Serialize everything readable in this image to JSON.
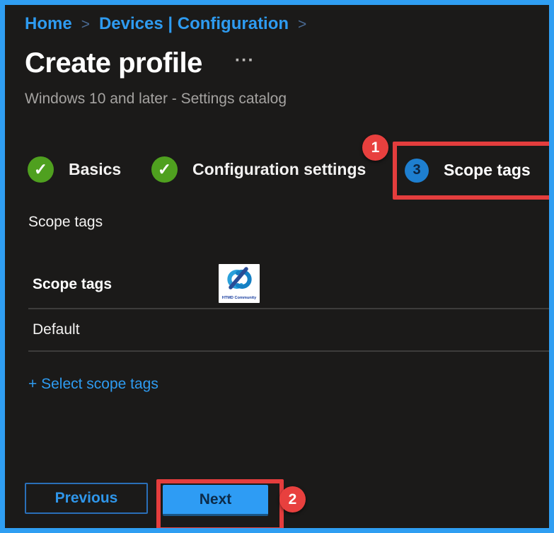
{
  "colors": {
    "frame_border": "#2f9ef2",
    "background": "#1b1a19",
    "link_blue": "#2e9bf0",
    "annotation_red": "#e43d3d",
    "step_complete_green": "#4fa01f",
    "step_current_blue": "#1e7fd0",
    "next_button_fill": "#2e9cf4",
    "divider_gray": "#3d3c3b"
  },
  "breadcrumb": {
    "items": [
      "Home",
      "Devices | Configuration"
    ],
    "separator": ">"
  },
  "header": {
    "title": "Create profile",
    "more_glyph": "···",
    "subtitle": "Windows 10 and later - Settings catalog"
  },
  "wizard": {
    "steps": [
      {
        "label": "Basics",
        "state": "complete"
      },
      {
        "label": "Configuration settings",
        "state": "complete"
      },
      {
        "label": "Scope tags",
        "state": "current",
        "number": "3"
      }
    ]
  },
  "icons": {
    "check": "✓"
  },
  "annotations": {
    "callout_1": "1",
    "callout_2": "2"
  },
  "section": {
    "label": "Scope tags"
  },
  "table": {
    "header": "Scope tags",
    "rows": [
      "Default"
    ]
  },
  "logo": {
    "text": "HTMD Community"
  },
  "actions": {
    "select_scope_tags": "+ Select scope tags",
    "previous": "Previous",
    "next": "Next"
  }
}
